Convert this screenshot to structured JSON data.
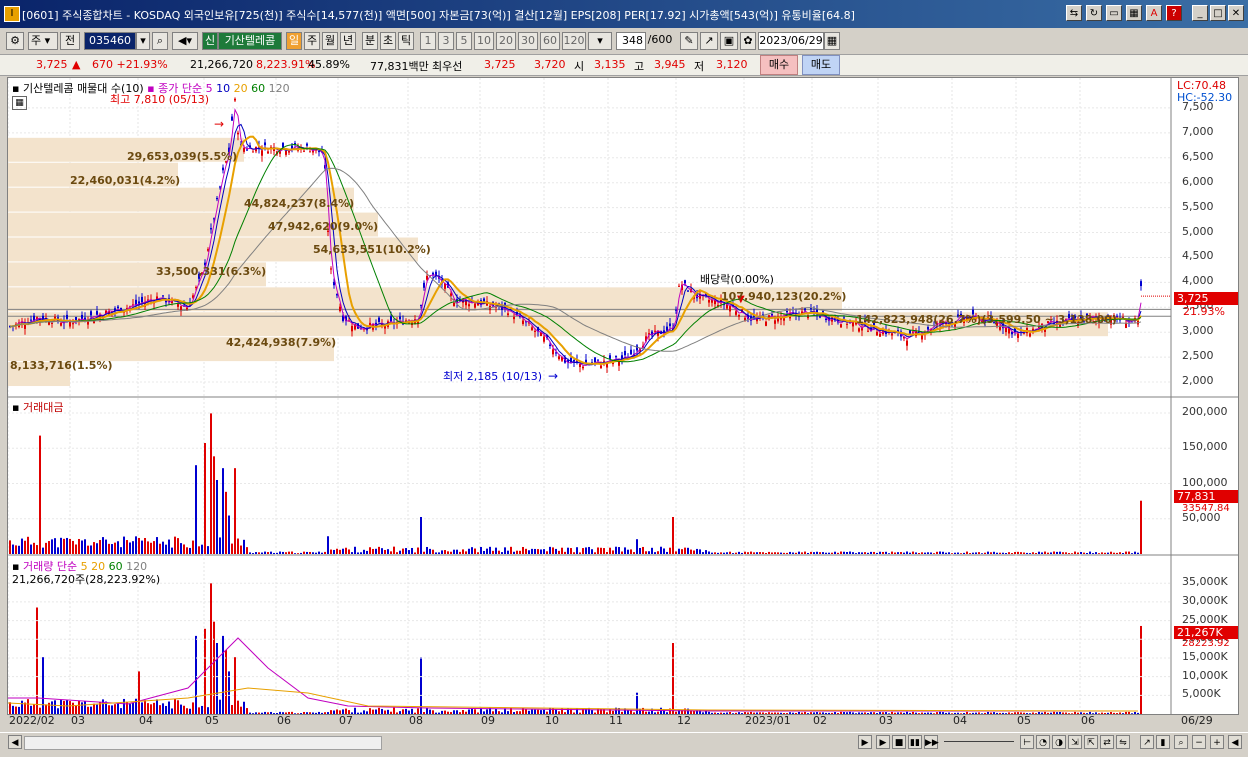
{
  "window": {
    "title": "[0601] 주식종합차트 - KOSDAQ 외국인보유[725(천)] 주식수[14,577(천)] 액면[500] 자본금[73(억)] 결산[12월] EPS[208] PER[17.92] 시가총액[543(억)] 유통비율[64.8]",
    "app_icon": "I"
  },
  "toolbar": {
    "period_type": "주",
    "prev_label": "전",
    "code_value": "035460",
    "stock_name": "기산텔레콤",
    "badge_new": "신",
    "periods": [
      "일",
      "주",
      "월",
      "년",
      "분",
      "초",
      "틱"
    ],
    "active_period": "일",
    "numbers": [
      "1",
      "3",
      "5",
      "10",
      "20",
      "30",
      "60",
      "120"
    ],
    "count_value": "348",
    "count_total": "/600",
    "date_value": "2023/06/29"
  },
  "info": {
    "price": "3,725",
    "change": "670 +21.93%",
    "volume": "21,266,720",
    "volume_pct": "8,223.91%",
    "foreign_pct": "45.89%",
    "amount": "77,831백만",
    "best_ask_label": "최우선",
    "best_ask": "3,725",
    "best_bid": "3,720",
    "open_label": "시",
    "open": "3,135",
    "high_label": "고",
    "high": "3,945",
    "low_label": "저",
    "low": "3,120",
    "buy_button": "매수",
    "sell_button": "매도"
  },
  "price_pane": {
    "legend_title": "기산텔레콤 매물대 수(10)",
    "legend_ma": "종가 단순",
    "legend_periods": [
      "5",
      "10",
      "20",
      "60",
      "120"
    ],
    "lc": "LC:70.48",
    "hc": "HC:-52.30",
    "high_mark": "최고 7,810 (05/13)",
    "low_mark": "최저 2,185 (10/13)",
    "dividend_mark": "배당락(0.00%)",
    "last_price_tag": "3,725",
    "last_pct_tag": "21.93%",
    "volume_profile_labels": [
      "29,653,039(5.5%)",
      "22,460,031(4.2%)",
      "44,824,237(8.4%)",
      "47,942,620(9.0%)",
      "54,633,551(10.2%)",
      "33,500,331(6.3%)",
      "107,940,123(20.2%)",
      "142,823,948(26.7%)(3,599.50 ~ 3,138.00)",
      "42,424,938(7.9%)",
      "8,133,716(1.5%)"
    ],
    "y_ticks": [
      "7,500",
      "7,000",
      "6,500",
      "6,000",
      "5,500",
      "5,000",
      "4,500",
      "4,000",
      "3,500",
      "3,000",
      "2,500",
      "2,000"
    ]
  },
  "amount_pane": {
    "title": "거래대금",
    "y_ticks": [
      "200,000",
      "150,000",
      "100,000",
      "50,000"
    ],
    "last_tag": "77,831",
    "ma_tag": "33547.84"
  },
  "volume_pane": {
    "title": "거래량 단순",
    "periods": [
      "5",
      "20",
      "60",
      "120"
    ],
    "subtitle": "21,266,720주(28,223.92%)",
    "y_ticks": [
      "35,000K",
      "30,000K",
      "25,000K",
      "20,000K",
      "15,000K",
      "10,000K",
      "5,000K"
    ],
    "last_tag": "21,267K",
    "ma_tag": "28223.92"
  },
  "x_labels": [
    "2022/02",
    "03",
    "04",
    "05",
    "06",
    "07",
    "08",
    "09",
    "10",
    "11",
    "12",
    "2023/01",
    "02",
    "03",
    "04",
    "05",
    "06",
    "06/29"
  ],
  "colors": {
    "up": "#e00000",
    "down": "#0000d0",
    "ma5": "#c000c0",
    "ma10": "#0000c0",
    "ma20": "#e8a000",
    "ma60": "#008000",
    "ma120": "#808080",
    "profile": "#f3e3cc"
  }
}
